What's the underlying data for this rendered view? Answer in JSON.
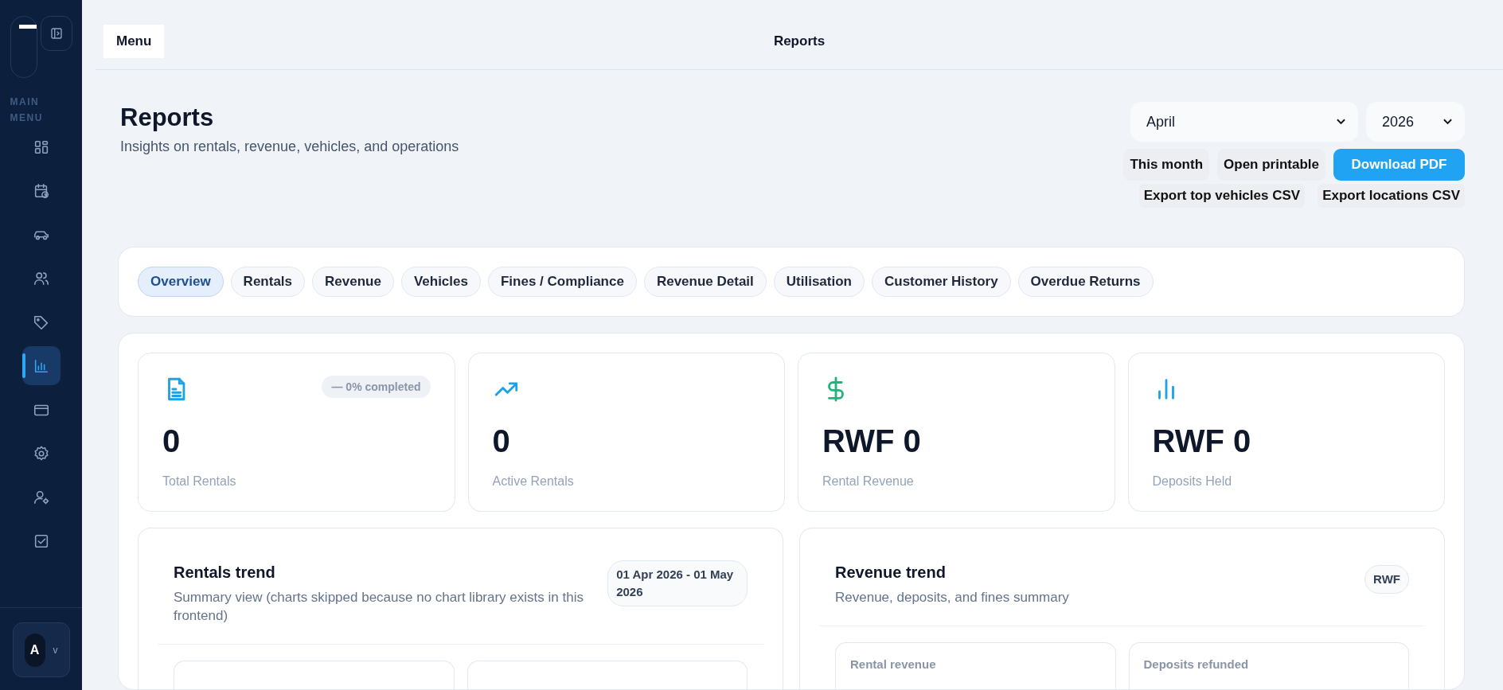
{
  "sidebar": {
    "section_label": "MAIN MENU",
    "items": [
      {
        "selected": false
      },
      {
        "selected": false
      },
      {
        "selected": false
      },
      {
        "selected": false
      },
      {
        "selected": false
      },
      {
        "selected": true
      },
      {
        "selected": false
      },
      {
        "selected": false
      },
      {
        "selected": false
      },
      {
        "selected": false
      }
    ],
    "user": {
      "initial": "A",
      "caret": "v"
    }
  },
  "topbar": {
    "menu_button": "Menu",
    "title": "Reports"
  },
  "header": {
    "title": "Reports",
    "subtitle": "Insights on rentals, revenue, vehicles, and operations",
    "month": "April",
    "year": "2026",
    "buttons": [
      {
        "label": "This month",
        "kind": "soft"
      },
      {
        "label": "Open printable",
        "kind": "soft"
      },
      {
        "label": "Download PDF",
        "kind": "primary"
      }
    ],
    "exports": [
      "Export top vehicles CSV",
      "Export locations CSV"
    ]
  },
  "tabs": [
    {
      "label": "Overview",
      "selected": true
    },
    {
      "label": "Rentals",
      "selected": false
    },
    {
      "label": "Revenue",
      "selected": false
    },
    {
      "label": "Vehicles",
      "selected": false
    },
    {
      "label": "Fines / Compliance",
      "selected": false
    },
    {
      "label": "Revenue Detail",
      "selected": false
    },
    {
      "label": "Utilisation",
      "selected": false
    },
    {
      "label": "Customer History",
      "selected": false
    },
    {
      "label": "Overdue Returns",
      "selected": false
    }
  ],
  "kpis": [
    {
      "value": "0",
      "label": "Total Rentals",
      "badge": "— 0% completed",
      "color": "#1ea1e6"
    },
    {
      "value": "0",
      "label": "Active Rentals",
      "color": "#1ea1e6"
    },
    {
      "value": "RWF 0",
      "label": "Rental Revenue",
      "color": "#1fb57a"
    },
    {
      "value": "RWF 0",
      "label": "Deposits Held",
      "color": "#1ea1e6"
    }
  ],
  "trends": [
    {
      "title": "Rentals trend",
      "subtitle": "Summary view (charts skipped because no chart library exists in this frontend)",
      "badge": "01 Apr 2026 - 01 May 2026",
      "tiles": [
        {
          "kind": "placeholder"
        },
        {
          "kind": "placeholder"
        }
      ]
    },
    {
      "title": "Revenue trend",
      "subtitle": "Revenue, deposits, and fines summary",
      "badge": "RWF",
      "tiles": [
        {
          "kind": "stat",
          "label": "Rental revenue"
        },
        {
          "kind": "stat",
          "label": "Deposits refunded"
        }
      ]
    }
  ]
}
